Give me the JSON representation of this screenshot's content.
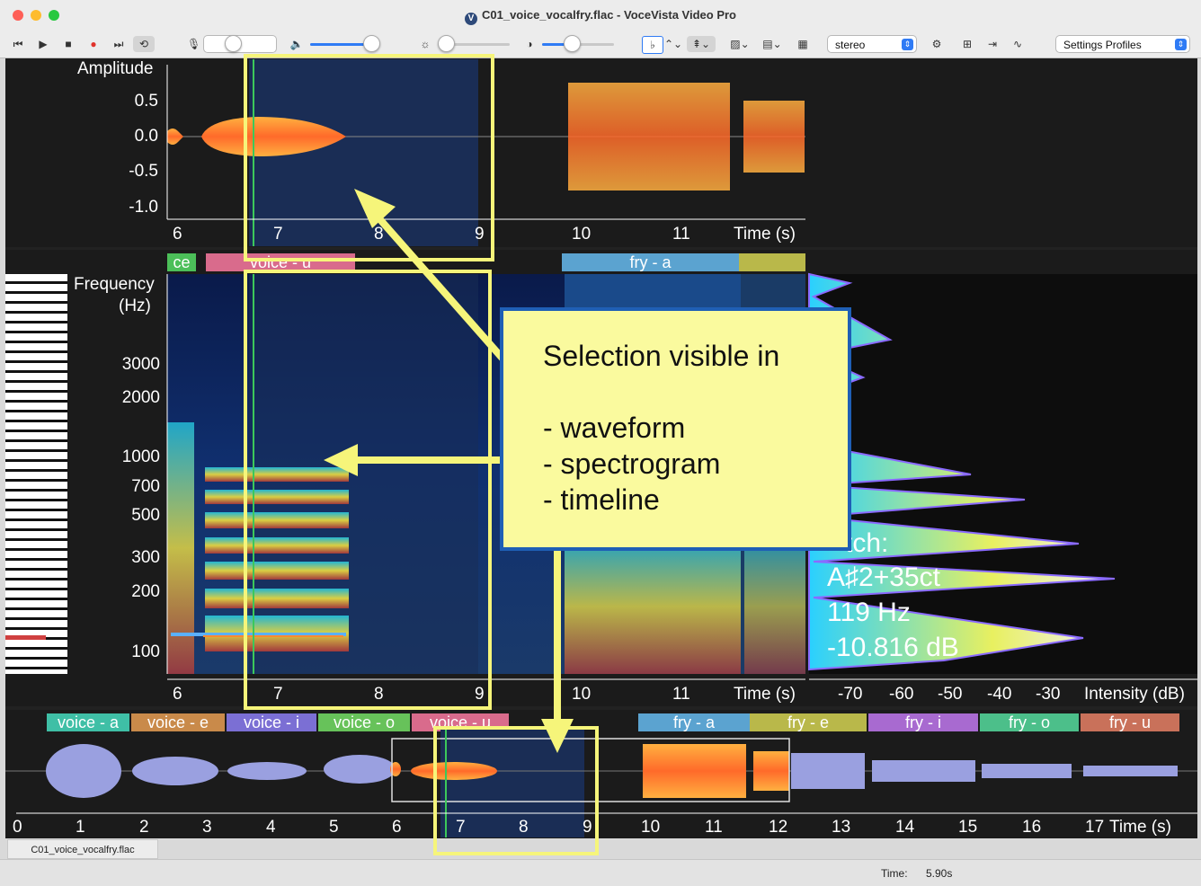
{
  "window": {
    "title": "C01_voice_vocalfry.flac - VoceVista Video Pro",
    "traffic_colors": [
      "#fe5f57",
      "#febc2e",
      "#28c840"
    ]
  },
  "toolbar": {
    "transport": [
      "skip-back",
      "play",
      "stop",
      "record",
      "skip-forward",
      "loop"
    ],
    "channel_select": "stereo",
    "settings_profiles": "Settings Profiles",
    "sliders": {
      "mic_level": 0.48,
      "volume": 0.78,
      "brightness": 0.05,
      "contrast": 0.42
    }
  },
  "waveform": {
    "ylabel": "Amplitude",
    "yticks": [
      "0.5",
      "0.0",
      "-0.5",
      "-1.0"
    ],
    "xticks": [
      "6",
      "7",
      "8",
      "9",
      "10",
      "11"
    ],
    "xlabel": "Time (s)"
  },
  "spectrogram": {
    "ylabel_line1": "Frequency",
    "ylabel_line2": "(Hz)",
    "yticks": [
      "3000",
      "2000",
      "1000",
      "700",
      "500",
      "300",
      "200",
      "100"
    ],
    "xticks": [
      "6",
      "7",
      "8",
      "9",
      "10",
      "11"
    ],
    "xlabel": "Time (s)",
    "labels": [
      {
        "text": "ce",
        "color": "#4cbf59"
      },
      {
        "text": "voice - u",
        "color": "#d96b8c"
      },
      {
        "text": "fry - a",
        "color": "#5ba3d0"
      },
      {
        "text": "",
        "color": "#b9b84a"
      }
    ]
  },
  "spectrum": {
    "xticks": [
      "-70",
      "-60",
      "-50",
      "-40",
      "-30"
    ],
    "xlabel": "Intensity (dB)",
    "pitch_label": "tch:",
    "pitch_note": "A♯2+35ct",
    "pitch_hz": "119 Hz",
    "pitch_db": "-10.816 dB"
  },
  "timeline": {
    "xticks": [
      "0",
      "1",
      "2",
      "3",
      "4",
      "5",
      "6",
      "7",
      "8",
      "9",
      "10",
      "11",
      "12",
      "13",
      "14",
      "15",
      "16",
      "17"
    ],
    "xlabel": "Time (s)",
    "labels": [
      {
        "text": "voice - a",
        "color": "#3fbfa6"
      },
      {
        "text": "voice - e",
        "color": "#c98a4a"
      },
      {
        "text": "voice - i",
        "color": "#7b6fd4"
      },
      {
        "text": "voice - o",
        "color": "#67c25a"
      },
      {
        "text": "voice - u",
        "color": "#d96b8c"
      },
      {
        "text": "fry - a",
        "color": "#5ba3d0"
      },
      {
        "text": "fry - e",
        "color": "#b9b84a"
      },
      {
        "text": "fry - i",
        "color": "#a86ad0"
      },
      {
        "text": "fry - o",
        "color": "#4cbf8a"
      },
      {
        "text": "fry - u",
        "color": "#c9715a"
      }
    ]
  },
  "callout": {
    "line1": "Selection visible in",
    "line2": "- waveform",
    "line3": "- spectrogram",
    "line4": "- timeline"
  },
  "file_tab": "C01_voice_vocalfry.flac",
  "status": {
    "time_label": "Time:",
    "time_value": "5.90s"
  },
  "colors": {
    "highlight": "#f6f57a",
    "callout_border": "#1f5fb5",
    "selection": "#1a2d55",
    "cursor": "#3cc85a"
  }
}
